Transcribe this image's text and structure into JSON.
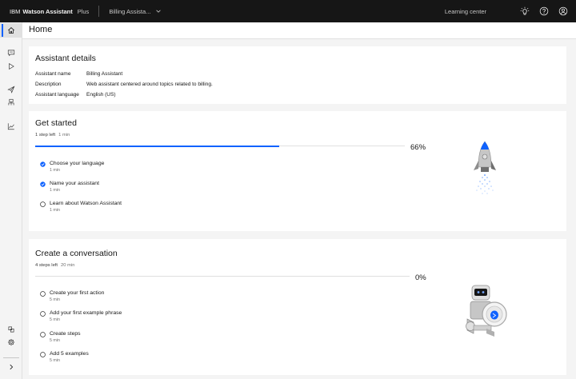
{
  "header": {
    "brand_ibm": "IBM",
    "brand_product": "Watson Assistant",
    "brand_plan": "Plus",
    "assistant_name": "Billing Assista...",
    "learning_center": "Learning center",
    "icons": [
      "whats-new-icon",
      "help-icon",
      "user-avatar-icon"
    ]
  },
  "sidebar": {
    "items": [
      {
        "name": "home",
        "icon": "home-icon",
        "active": true
      },
      {
        "name": "actions",
        "icon": "chat-icon"
      },
      {
        "name": "preview",
        "icon": "play-icon"
      },
      {
        "name": "publish",
        "icon": "send-icon"
      },
      {
        "name": "integrations",
        "icon": "integrations-icon"
      },
      {
        "name": "analyze",
        "icon": "chart-icon"
      },
      {
        "name": "environments",
        "icon": "deploy-icon"
      },
      {
        "name": "settings",
        "icon": "gear-icon"
      },
      {
        "name": "expand",
        "icon": "chevron-right-icon"
      }
    ]
  },
  "page": {
    "title": "Home"
  },
  "assistant_details": {
    "title": "Assistant details",
    "rows": [
      {
        "key": "Assistant name",
        "value": "Billing Assistant"
      },
      {
        "key": "Description",
        "value": "Web assistant centered around topics related to billing."
      },
      {
        "key": "Assistant language",
        "value": "English (US)"
      }
    ]
  },
  "get_started": {
    "title": "Get started",
    "steps_left": "1 step left",
    "time_left": "1 min",
    "progress_label": "66%",
    "progress": 0.66,
    "steps": [
      {
        "label": "Choose your language",
        "duration": "1 min",
        "done": true
      },
      {
        "label": "Name your assistant",
        "duration": "1 min",
        "done": true
      },
      {
        "label": "Learn about Watson Assistant",
        "duration": "1 min",
        "done": false
      }
    ]
  },
  "create_conversation": {
    "title": "Create a conversation",
    "steps_left": "4 steps left",
    "time_left": "20 min",
    "progress_label": "0%",
    "progress": 0,
    "steps": [
      {
        "label": "Create your first action",
        "duration": "5 min",
        "done": false
      },
      {
        "label": "Add your first example phrase",
        "duration": "5 min",
        "done": false
      },
      {
        "label": "Create steps",
        "duration": "5 min",
        "done": false
      },
      {
        "label": "Add 5 examples",
        "duration": "5 min",
        "done": false
      }
    ]
  },
  "colors": {
    "accent": "#0f62fe",
    "header_bg": "#161616",
    "page_bg": "#f4f4f4"
  }
}
